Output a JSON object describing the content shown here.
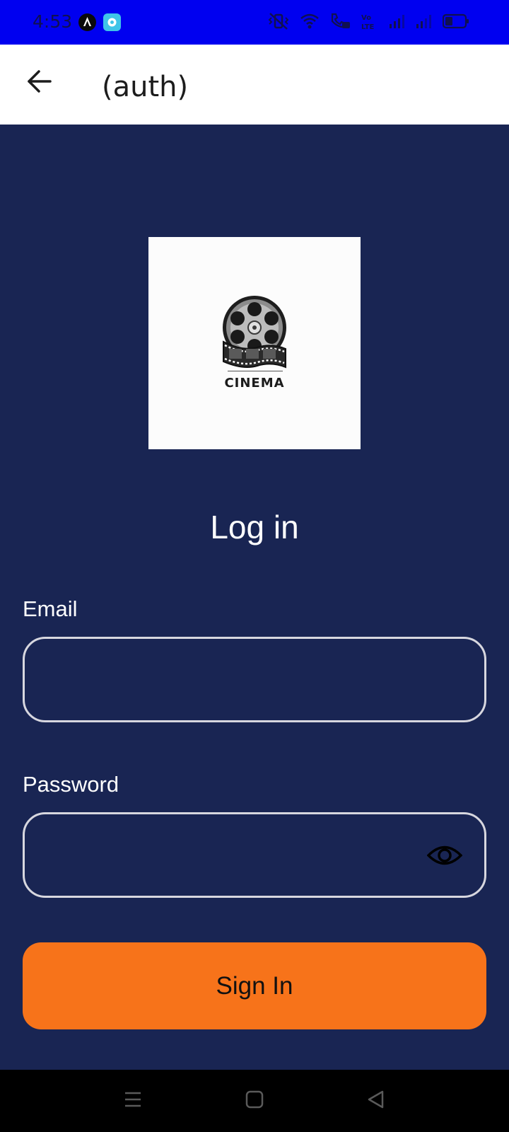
{
  "status_bar": {
    "time": "4:53",
    "icons": [
      "app-a-icon",
      "app-b-icon",
      "vibrate-icon",
      "wifi-icon",
      "wifi-calling-icon",
      "volte-icon",
      "signal-1-icon",
      "signal-2-icon",
      "battery-icon"
    ]
  },
  "header": {
    "title": "(auth)",
    "back_icon": "arrow-left-icon"
  },
  "logo": {
    "text": "CINEMA",
    "icon": "film-reel-icon"
  },
  "login": {
    "title": "Log in",
    "email_label": "Email",
    "email_value": "",
    "password_label": "Password",
    "password_value": "",
    "password_toggle_icon": "eye-icon",
    "submit_label": "Sign In"
  },
  "colors": {
    "status_bar": "#0000f0",
    "background": "#192553",
    "accent": "#f7731a",
    "input_border": "#d7d7df"
  },
  "nav_bar": {
    "buttons": [
      "menu-icon",
      "home-icon",
      "back-icon"
    ]
  }
}
